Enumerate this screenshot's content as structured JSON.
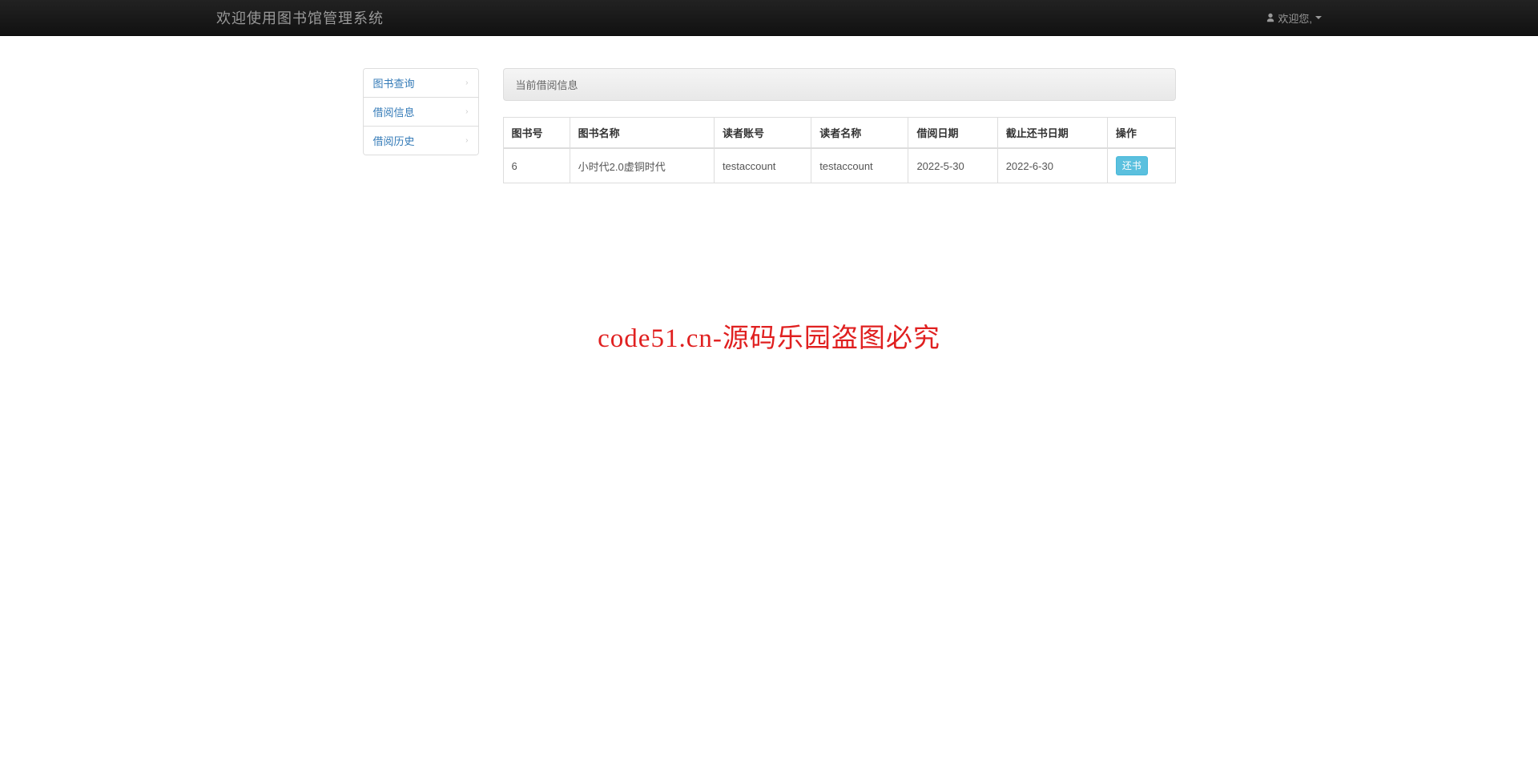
{
  "navbar": {
    "brand": "欢迎使用图书馆管理系统",
    "welcome": "欢迎您,"
  },
  "sidebar": {
    "items": [
      {
        "label": "图书查询"
      },
      {
        "label": "借阅信息"
      },
      {
        "label": "借阅历史"
      }
    ]
  },
  "panel": {
    "title": "当前借阅信息"
  },
  "table": {
    "headers": [
      "图书号",
      "图书名称",
      "读者账号",
      "读者名称",
      "借阅日期",
      "截止还书日期",
      "操作"
    ],
    "rows": [
      {
        "book_id": "6",
        "book_name": "小时代2.0虚铜时代",
        "reader_account": "testaccount",
        "reader_name": "testaccount",
        "borrow_date": "2022-5-30",
        "due_date": "2022-6-30",
        "action_label": "还书"
      }
    ]
  },
  "watermark": "code51.cn-源码乐园盗图必究"
}
